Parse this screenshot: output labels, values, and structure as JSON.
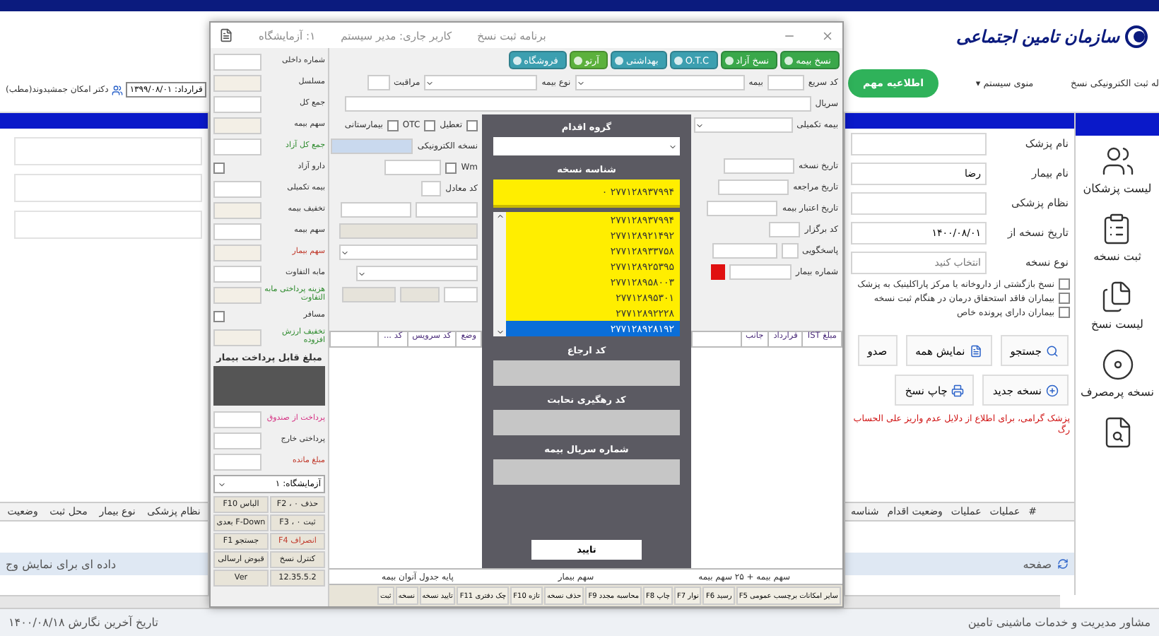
{
  "header": {
    "org_name": "سازمان تامین اجتماعی",
    "app_title": "له ثبت الکترونیکی نسخ",
    "system_menu": "منوی سیستم ▾",
    "notice_button": "اطلاعیه مهم",
    "user_name": "دکتر امکان جمشیدوند(مطب)",
    "contract": "قرارداد: ۱۳۹۹/۰۸/۰۱"
  },
  "sidebar": {
    "items": [
      {
        "kind": "doctors",
        "label": "لیست پزشکان"
      },
      {
        "kind": "new_prescription",
        "label": "ثبت نسخه"
      },
      {
        "kind": "prescriptions",
        "label": "لیست نسخ"
      },
      {
        "kind": "frequent",
        "label": "نسخه پرمصرف"
      },
      {
        "kind": "search_doc"
      }
    ]
  },
  "search_form": {
    "fields": [
      {
        "label": "نام پزشک"
      },
      {
        "label": "نام بیمار",
        "value": "رضا"
      },
      {
        "label": "نظام پزشکی"
      },
      {
        "label": "تاریخ نسخه از",
        "value": "۱۴۰۰/۰۸/۰۱"
      },
      {
        "label": "نوع نسخه",
        "placeholder": "انتخاب کنید"
      }
    ],
    "checkboxes": [
      {
        "label": "نسخ بازگشتی از داروخانه یا مرکز پاراکلینیک به پزشک",
        "checked": false
      },
      {
        "label": "بیماران فاقد استحقاق درمان در هنگام ثبت نسخه",
        "checked": false
      },
      {
        "label": "بیماران دارای پرونده خاص",
        "checked": false
      }
    ],
    "button_rows": [
      [
        {
          "kind": "search",
          "label": "جستجو"
        },
        {
          "kind": "show_all",
          "label": "نمایش همه"
        },
        {
          "kind": "plain",
          "label": "صدو"
        }
      ],
      [
        {
          "kind": "new",
          "label": "نسخه جدید"
        },
        {
          "kind": "print",
          "label": "چاپ نسخ"
        }
      ]
    ]
  },
  "notice": "پزشک گرامی، برای اطلاع از دلایل عدم واریز علی الحساب رگ",
  "results_table": {
    "columns_right": [
      "#",
      "عملیات",
      "عملیات",
      "وضعیت اقدام",
      "شناسه"
    ],
    "columns_left": [
      "نظام پزشکی",
      "نوع بیمار",
      "محل ثبت",
      "وضعیت"
    ],
    "empty_message": "داده ای برای نمایش وج",
    "page_label": "صفحه"
  },
  "footer": {
    "company": "مشاور مدیریت و خدمات ماشینی تامین",
    "last_update": "تاریخ آخرین نگارش ۱۴۰۰/۰۸/۱۸"
  },
  "dialog": {
    "title": "برنامه ثبت نسخ",
    "user": "کاربر جاری: مدیر سیستم",
    "unit": "۱: آزمایشگاه",
    "tabs": [
      {
        "label": "نسخ بیمه",
        "color": "#3aa84a"
      },
      {
        "label": "نسخ آزاد",
        "color": "#3aa84a"
      },
      {
        "label": "O.T.C",
        "color": "#3c9fb0"
      },
      {
        "label": "بهداشتی",
        "color": "#3c9fb0"
      },
      {
        "label": "آرتو",
        "color": "#5cb13c"
      },
      {
        "label": "فروشگاه",
        "color": "#3c9fb0"
      }
    ],
    "summary": [
      {
        "kind": "field",
        "label": "شماره داخلی"
      },
      {
        "kind": "field",
        "label": "مسلسل"
      },
      {
        "kind": "field",
        "label": "جمع کل"
      },
      {
        "kind": "field",
        "label": "سهم بیمه"
      },
      {
        "kind": "field",
        "label": "جمع کل آزاد",
        "color": "#2e8b2e"
      },
      {
        "kind": "check",
        "label": "دارو آزاد",
        "checked": false
      },
      {
        "kind": "field",
        "label": "بیمه تکمیلی"
      },
      {
        "kind": "field",
        "label": "تخفیف بیمه"
      },
      {
        "kind": "field",
        "label": "سهم بیمه"
      },
      {
        "kind": "field",
        "label": "سهم بیمار",
        "color": "#c0392b"
      },
      {
        "kind": "field",
        "label": "مابه التفاوت"
      },
      {
        "kind": "field",
        "label": "هزینه پرداختی مابه التفاوت",
        "color": "#2e8b2e"
      },
      {
        "kind": "check",
        "label": "مسافر",
        "checked": false
      },
      {
        "kind": "field",
        "label": "تخفیف ارزش افزوده",
        "color": "#2e8b2e"
      }
    ],
    "payable_label": "مبلغ قابل پرداخت بیمار",
    "payments": [
      {
        "label": "پرداخت از صندوق",
        "color": "#d63384"
      },
      {
        "label": "پرداختی خارج",
        "color": "#333333"
      },
      {
        "label": "مبلغ مانده",
        "color": "#c0392b"
      }
    ],
    "unit_select": "آزمایشگاه: ۱",
    "keys": [
      {
        "label": "حذف F2 ، ۰",
        "color": "#222222"
      },
      {
        "label": "الباس F10",
        "color": "#222222"
      },
      {
        "label": "ثبت F3 ، ۰",
        "color": "#222222"
      },
      {
        "label": "F-Down بعدی",
        "color": "#222222"
      },
      {
        "label": "انصراف F4",
        "color": "#c0392b"
      },
      {
        "label": "جستجو F1",
        "color": "#222222"
      },
      {
        "label": "کنترل نسخ",
        "color": "#222222"
      },
      {
        "label": "قبوض ارسالی",
        "color": "#222222"
      },
      {
        "label": "12.35.5.2",
        "color": "#222222"
      },
      {
        "label": "Ver",
        "color": "#222222"
      }
    ],
    "row1": {
      "quick_code": "کد سریع",
      "insurance": "بیمه",
      "insurance_type": "نوع بیمه",
      "care": "مراقبت"
    },
    "serial_label": "سریال",
    "flags": [
      {
        "label": "تعطیل",
        "checked": false
      },
      {
        "label": "OTC",
        "checked": false
      },
      {
        "label": "بیمارستانی",
        "checked": false
      }
    ],
    "electronic_label": "نسخه الکترونیکی",
    "wm_label": "Wm",
    "wm_checked": false,
    "equivalent_label": "کد معادل",
    "supplementary_label": "بیمه تکمیلی",
    "date_fields": [
      "تاریخ نسخه",
      "تاریخ مراجعه",
      "تاریخ اعتبار بیمه"
    ],
    "contract_code_label": "کد برگزار",
    "response_label": "پاسخگویی",
    "patient_number_label": "شماره بیمار",
    "grid_left": [
      "وضع",
      "کد سرویس",
      "کد ..."
    ],
    "grid_right": [
      "مبلغ IST",
      "قرارداد",
      "جانب"
    ],
    "status": [
      "سهم بیمه + ۲۵ سهم بیمه",
      "سهم بیمار",
      "پایه جدول آنوان بیمه"
    ],
    "fkeys": [
      "سایر امکانات برچسب عمومی F5",
      "رسید F6",
      "نوار F7",
      "چاپ F8",
      "محاسبه مجدد F9",
      "حذف نسخه",
      "تازه F10",
      "چک دفتری F11",
      "تایید نسخه",
      "نسخه",
      "ثبت"
    ]
  },
  "modal": {
    "title": "گروه اقدام",
    "id_label": "شناسه نسخه",
    "current_id": "۲۷۷۱۲۸۹۳۷۹۹۴ ۰",
    "ids": [
      {
        "value": "۲۷۷۱۲۸۹۳۷۹۹۴",
        "selected": false
      },
      {
        "value": "۲۷۷۱۲۸۹۲۱۴۹۲",
        "selected": false
      },
      {
        "value": "۲۷۷۱۲۸۹۳۳۷۵۸",
        "selected": false
      },
      {
        "value": "۲۷۷۱۲۸۹۲۵۳۹۵",
        "selected": false
      },
      {
        "value": "۲۷۷۱۲۸۹۵۸۰۰۳",
        "selected": false
      },
      {
        "value": "۲۷۷۱۲۸۹۵۳۰۱",
        "selected": false
      },
      {
        "value": "۲۷۷۱۲۸۹۲۲۲۸",
        "selected": false
      },
      {
        "value": "۲۷۷۱۲۸۹۲۸۱۹۲",
        "selected": true
      }
    ],
    "fields": [
      "کد ارجاع",
      "کد رهگیری نحابت",
      "شماره سریال بیمه"
    ],
    "confirm": "تایید"
  }
}
